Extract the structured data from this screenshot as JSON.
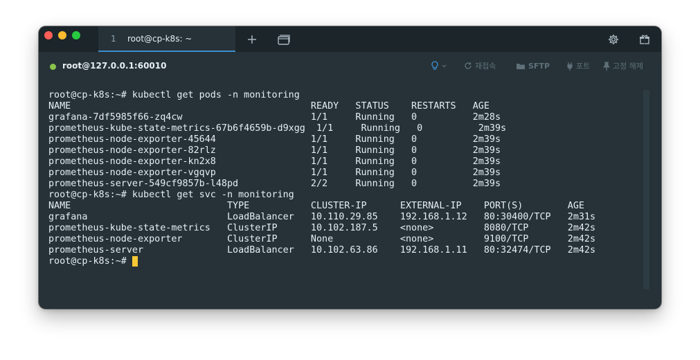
{
  "tab": {
    "index": "1",
    "title": "root@cp-k8s: ~"
  },
  "connection": {
    "label": "root@127.0.0.1:60010",
    "status_color": "#8bc34a"
  },
  "toolbar": {
    "reconnect": "재접속",
    "sftp": "SFTP",
    "port": "포트",
    "pin": "고정 해제"
  },
  "icons": {
    "new_tab": "plus-icon",
    "tab_overview": "window-icon",
    "settings": "gear-icon",
    "gift": "gift-icon",
    "hint": "lightbulb-icon",
    "reconnect": "refresh-icon",
    "sftp": "folder-icon",
    "port": "plug-icon",
    "pin": "pin-icon"
  },
  "terminal": {
    "lines": [
      "root@cp-k8s:~# kubectl get pods -n monitoring",
      "NAME                                           READY   STATUS    RESTARTS   AGE",
      "grafana-7df5985f66-zq4cw                       1/1     Running   0          2m28s",
      "prometheus-kube-state-metrics-67b6f4659b-d9xgg  1/1     Running   0          2m39s",
      "prometheus-node-exporter-45644                 1/1     Running   0          2m39s",
      "prometheus-node-exporter-82rlz                 1/1     Running   0          2m39s",
      "prometheus-node-exporter-kn2x8                 1/1     Running   0          2m39s",
      "prometheus-node-exporter-vgqvp                 1/1     Running   0          2m39s",
      "prometheus-server-549cf9857b-l48pd             2/2     Running   0          2m39s",
      "root@cp-k8s:~# kubectl get svc -n monitoring",
      "NAME                            TYPE           CLUSTER-IP      EXTERNAL-IP    PORT(S)        AGE",
      "grafana                         LoadBalancer   10.110.29.85    192.168.1.12   80:30400/TCP   2m31s",
      "prometheus-kube-state-metrics   ClusterIP      10.102.187.5    <none>         8080/TCP       2m42s",
      "prometheus-node-exporter        ClusterIP      None            <none>         9100/TCP       2m42s",
      "prometheus-server               LoadBalancer   10.102.63.86    192.168.1.11   80:32474/TCP   2m42s",
      "root@cp-k8s:~# "
    ]
  },
  "colors": {
    "background": "#263238",
    "tabbar": "#1b252a",
    "accent": "#3d8fd0",
    "cursor": "#f7c934",
    "text": "#e6eef2"
  }
}
